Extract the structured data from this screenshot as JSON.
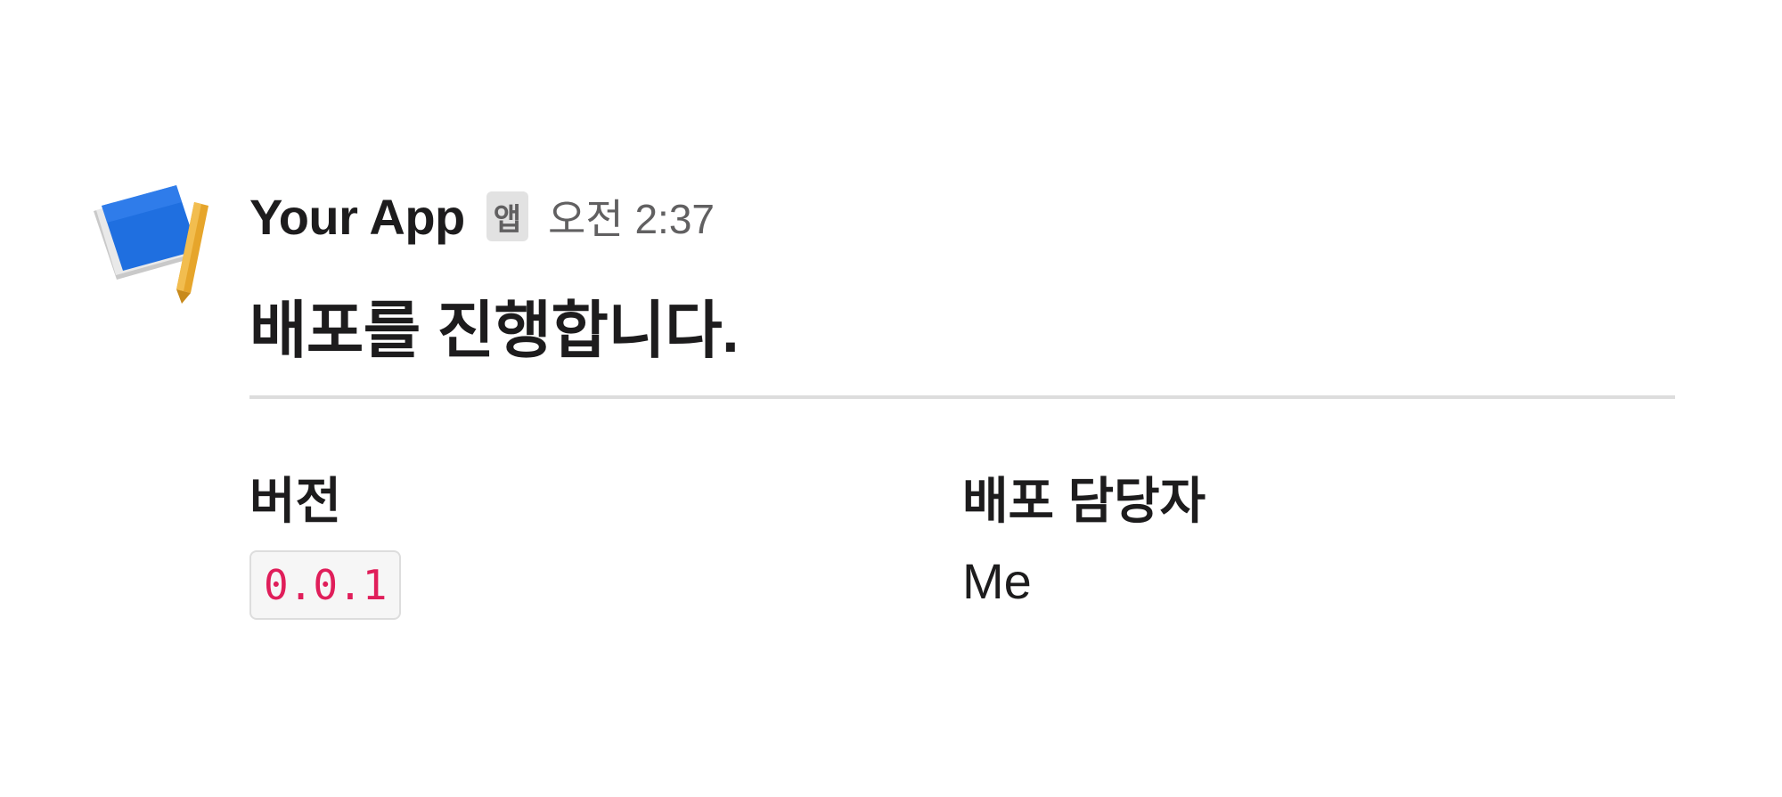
{
  "message": {
    "sender": "Your App",
    "app_badge": "앱",
    "timestamp": "오전 2:37",
    "avatar_icon": "blueprint-book-icon",
    "title": "배포를 진행합니다.",
    "fields": [
      {
        "label": "버전",
        "value": "0.0.1",
        "style": "code"
      },
      {
        "label": "배포 담당자",
        "value": "Me",
        "style": "text"
      }
    ]
  },
  "colors": {
    "code_text": "#e01e5a",
    "muted": "#616061",
    "divider": "#dddddd"
  }
}
